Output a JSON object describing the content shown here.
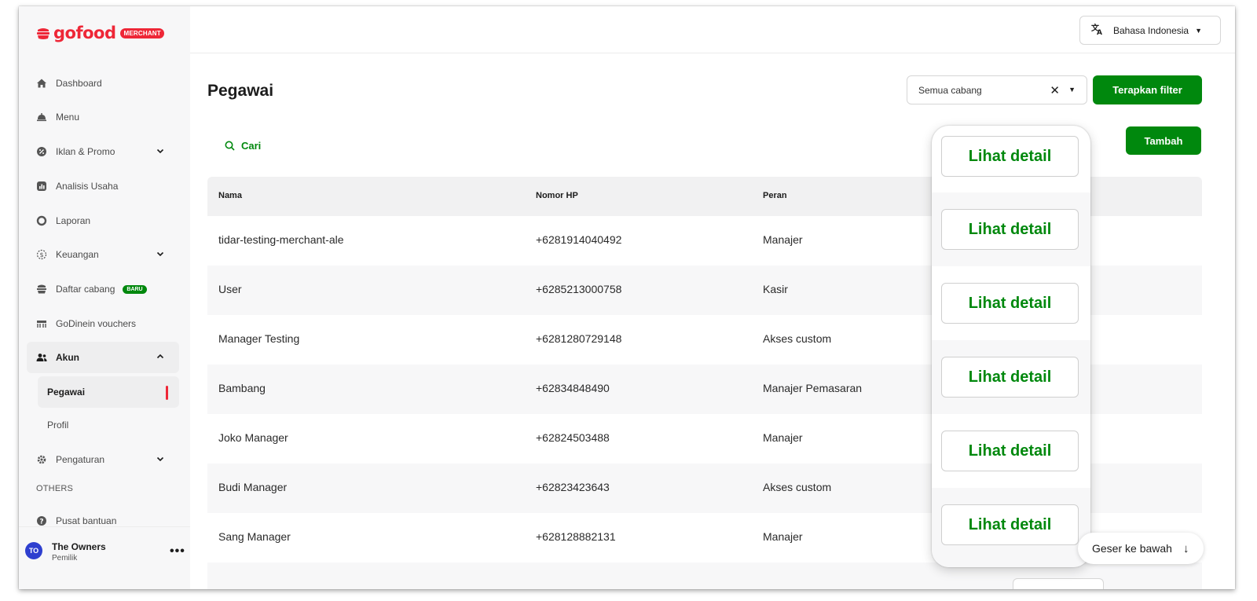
{
  "brand": {
    "word": "gofood",
    "badge": "MERCHANT",
    "color": "#ee2737"
  },
  "topbar": {
    "language_label": "Bahasa Indonesia"
  },
  "sidebar": {
    "items": [
      {
        "label": "Dashboard",
        "icon": "home-icon"
      },
      {
        "label": "Menu",
        "icon": "cloche-icon"
      },
      {
        "label": "Iklan & Promo",
        "icon": "promo-icon"
      },
      {
        "label": "Analisis Usaha",
        "icon": "analytics-icon"
      },
      {
        "label": "Laporan",
        "icon": "report-icon"
      },
      {
        "label": "Keuangan",
        "icon": "finance-icon"
      },
      {
        "label": "Daftar cabang",
        "icon": "store-icon",
        "badge": "BARU"
      },
      {
        "label": "GoDinein vouchers",
        "icon": "voucher-icon"
      },
      {
        "label": "Akun",
        "icon": "users-icon"
      },
      {
        "label": "Pengaturan",
        "icon": "gear-icon"
      },
      {
        "label": "Pusat bantuan",
        "icon": "help-icon"
      }
    ],
    "subitems": [
      {
        "label": "Pegawai"
      },
      {
        "label": "Profil"
      }
    ],
    "section_label": "OTHERS",
    "user": {
      "initials": "TO",
      "name": "The Owners",
      "role": "Pemilik",
      "more": "•••"
    }
  },
  "main": {
    "title": "Pegawai",
    "branch_filter": {
      "value": "Semua cabang",
      "clear": "✕"
    },
    "apply_filter_label": "Terapkan filter",
    "add_label": "Tambah",
    "search_label": "Cari",
    "table": {
      "headers": [
        "Nama",
        "Nomor HP",
        "Peran"
      ],
      "rows": [
        {
          "name": "tidar-testing-merchant-ale",
          "phone": "+6281914040492",
          "role": "Manajer"
        },
        {
          "name": "User",
          "phone": "+6285213000758",
          "role": "Kasir"
        },
        {
          "name": "Manager Testing",
          "phone": "+6281280729148",
          "role": "Akses custom"
        },
        {
          "name": "Bambang",
          "phone": "+62834848490",
          "role": "Manajer Pemasaran"
        },
        {
          "name": "Joko Manager",
          "phone": "+62824503488",
          "role": "Manajer"
        },
        {
          "name": "Budi Manager",
          "phone": "+62823423643",
          "role": "Akses custom"
        },
        {
          "name": "Sang Manager",
          "phone": "+628128882131",
          "role": "Manajer"
        }
      ]
    },
    "detail_label": "Lihat detail",
    "scroll_hint": "Geser ke bawah",
    "accent_color": "#00880d"
  }
}
